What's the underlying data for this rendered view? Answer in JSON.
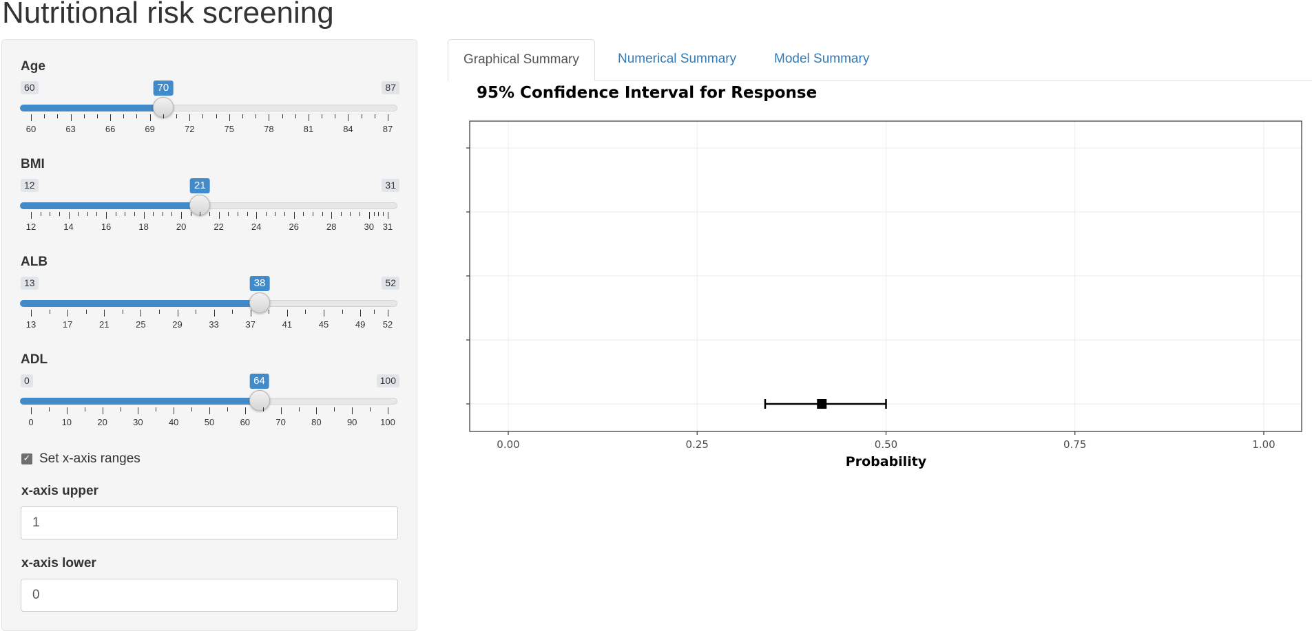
{
  "app": {
    "title": "Nutritional risk screening"
  },
  "sliders": [
    {
      "label": "Age",
      "min": 60,
      "max": 87,
      "value": 70,
      "ticks": [
        60,
        63,
        66,
        69,
        72,
        75,
        78,
        81,
        84,
        87
      ],
      "minor_per_major": 2
    },
    {
      "label": "BMI",
      "min": 12,
      "max": 31,
      "value": 21,
      "ticks": [
        12,
        14,
        16,
        18,
        20,
        22,
        24,
        26,
        28,
        30,
        31
      ],
      "minor_per_major": 3
    },
    {
      "label": "ALB",
      "min": 13,
      "max": 52,
      "value": 38,
      "ticks": [
        13,
        17,
        21,
        25,
        29,
        33,
        37,
        41,
        45,
        49,
        52
      ],
      "minor_per_major": 1
    },
    {
      "label": "ADL",
      "min": 0,
      "max": 100,
      "value": 64,
      "ticks": [
        0,
        10,
        20,
        30,
        40,
        50,
        60,
        70,
        80,
        90,
        100
      ],
      "minor_per_major": 1
    }
  ],
  "set_ranges": {
    "label": "Set x-axis ranges",
    "checked": true
  },
  "x_upper": {
    "label": "x-axis upper",
    "value": "1"
  },
  "x_lower": {
    "label": "x-axis lower",
    "value": "0"
  },
  "tabs": [
    {
      "label": "Graphical Summary",
      "active": true
    },
    {
      "label": "Numerical Summary",
      "active": false
    },
    {
      "label": "Model Summary",
      "active": false
    }
  ],
  "colors": {
    "accent": "#428bca",
    "link": "#337ab7"
  },
  "chart_data": {
    "type": "scatter",
    "title": "95% Confidence Interval for Response",
    "xlabel": "Probability",
    "ylabel": "",
    "xlim": [
      0,
      1
    ],
    "xticks": [
      "0.00",
      "0.25",
      "0.50",
      "0.75",
      "1.00"
    ],
    "grid": true,
    "rows": 5,
    "points": [
      {
        "row": 1,
        "estimate": 0.415,
        "lower": 0.34,
        "upper": 0.5
      }
    ]
  }
}
